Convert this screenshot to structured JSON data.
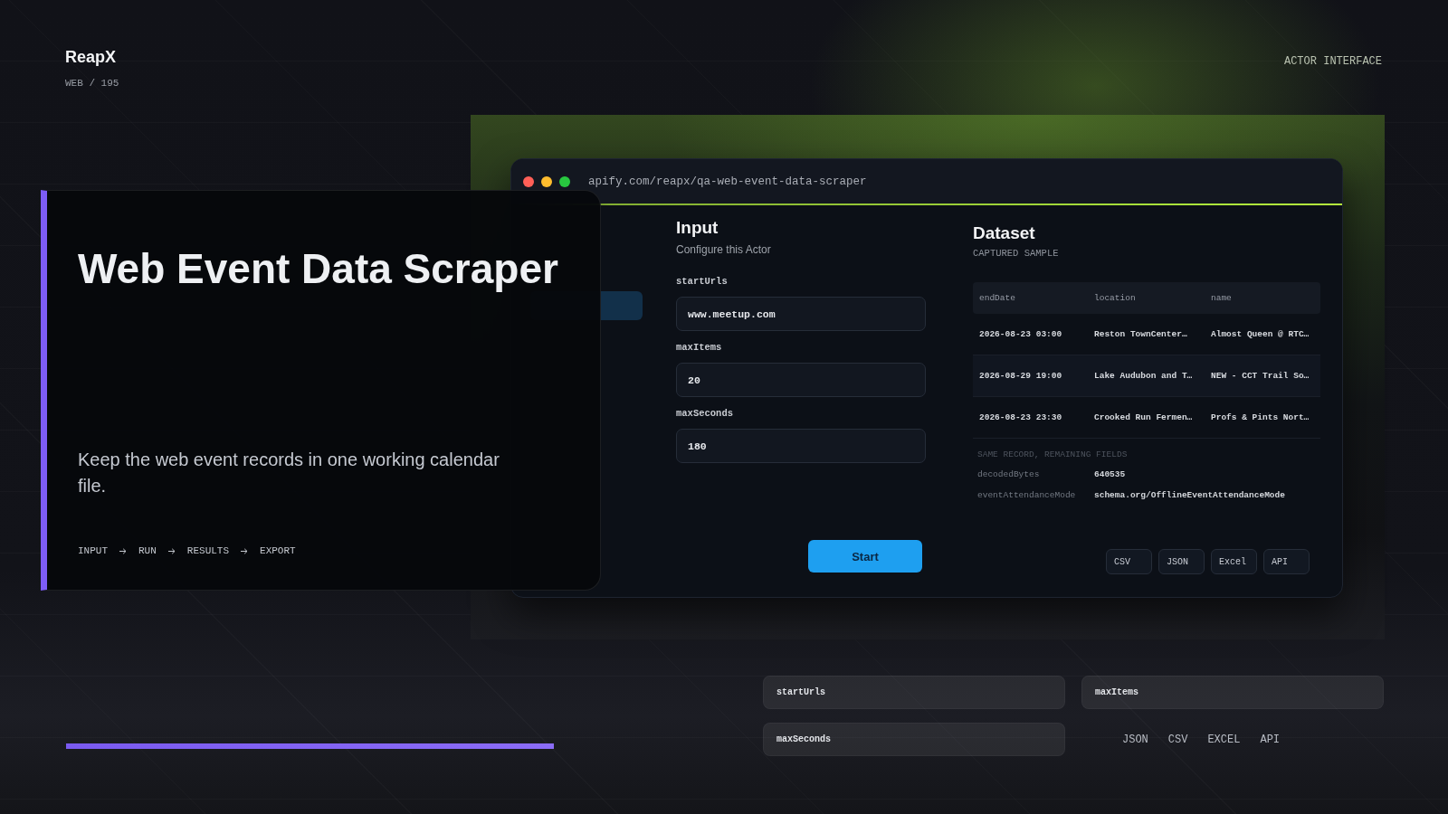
{
  "brand": {
    "name": "ReapX",
    "code": "WEB / 195"
  },
  "section_tag": "ACTOR INTERFACE",
  "hero": {
    "title": "Web Event Data Scraper",
    "description": "Keep the web event records in one working calendar file.",
    "flow": [
      "INPUT",
      "RUN",
      "RESULTS",
      "EXPORT"
    ]
  },
  "browser": {
    "url": "apify.com/reapx/qa-web-event-data-scraper",
    "input_panel": {
      "title": "Input",
      "subtitle": "Configure this Actor",
      "fields": [
        {
          "label": "startUrls",
          "value": "www.meetup.com"
        },
        {
          "label": "maxItems",
          "value": "20"
        },
        {
          "label": "maxSeconds",
          "value": "180"
        }
      ],
      "start_button": "Start"
    },
    "dataset_panel": {
      "title": "Dataset",
      "subtitle": "CAPTURED SAMPLE",
      "table": {
        "columns": [
          "endDate",
          "location",
          "name"
        ],
        "rows": [
          [
            "2026-08-23 03:00",
            "Reston TownCenter…",
            "Almost Queen @ RTC…"
          ],
          [
            "2026-08-29 19:00",
            "Lake Audubon and T…",
            "NEW - CCT Trail So…"
          ],
          [
            "2026-08-23 23:30",
            "Crooked Run Fermen…",
            "Profs & Pints Nort…"
          ]
        ]
      },
      "detail_heading": "SAME RECORD, REMAINING FIELDS",
      "details": [
        {
          "key": "decodedBytes",
          "value": "640535"
        },
        {
          "key": "eventAttendanceMode",
          "value": "schema.org/OfflineEventAttendanceMode"
        }
      ],
      "export_buttons": [
        "CSV",
        "JSON",
        "Excel",
        "API"
      ]
    }
  },
  "field_chips": [
    "startUrls",
    "maxItems",
    "maxSeconds"
  ],
  "formats": [
    "JSON",
    "CSV",
    "EXCEL",
    "API"
  ]
}
